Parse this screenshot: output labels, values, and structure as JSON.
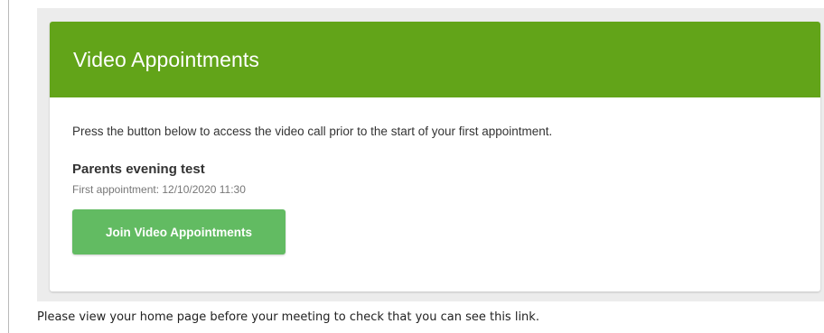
{
  "panel": {
    "title": "Video Appointments",
    "intro": "Press the button below to access the video call prior to the start of your first appointment.",
    "event_name": "Parents evening test",
    "first_appointment": "First appointment: 12/10/2020 11:30",
    "join_button_label": "Join Video Appointments"
  },
  "footer": {
    "note": "Please view your home page before your meeting to check that you can see this link."
  },
  "colors": {
    "header_green": "#62a419",
    "button_green": "#62bb62"
  }
}
